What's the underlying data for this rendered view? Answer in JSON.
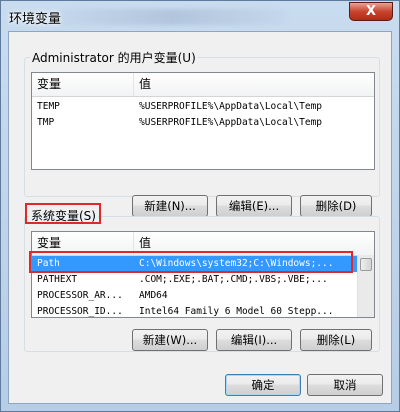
{
  "window": {
    "title": "环境变量",
    "close_label": "X"
  },
  "user_vars": {
    "group_label": "Administrator 的用户变量(U)",
    "columns": [
      "变量",
      "值"
    ],
    "rows": [
      {
        "name": "TEMP",
        "value": "%USERPROFILE%\\AppData\\Local\\Temp"
      },
      {
        "name": "TMP",
        "value": "%USERPROFILE%\\AppData\\Local\\Temp"
      }
    ],
    "buttons": {
      "new": "新建(N)...",
      "edit": "编辑(E)...",
      "delete": "删除(D)"
    }
  },
  "system_vars": {
    "group_label": "系统变量(S)",
    "columns": [
      "变量",
      "值"
    ],
    "rows": [
      {
        "name": "Path",
        "value": "C:\\Windows\\system32;C:\\Windows;...",
        "selected": true
      },
      {
        "name": "PATHEXT",
        "value": ".COM;.EXE;.BAT;.CMD;.VBS;.VBE;..."
      },
      {
        "name": "PROCESSOR_AR...",
        "value": "AMD64"
      },
      {
        "name": "PROCESSOR_ID...",
        "value": "Intel64 Family 6 Model 60 Stepp..."
      }
    ],
    "buttons": {
      "new": "新建(W)...",
      "edit": "编辑(I)...",
      "delete": "删除(L)"
    }
  },
  "footer": {
    "ok": "确定",
    "cancel": "取消"
  },
  "colors": {
    "highlight": "#3399ff",
    "annotation": "#e0282c"
  }
}
